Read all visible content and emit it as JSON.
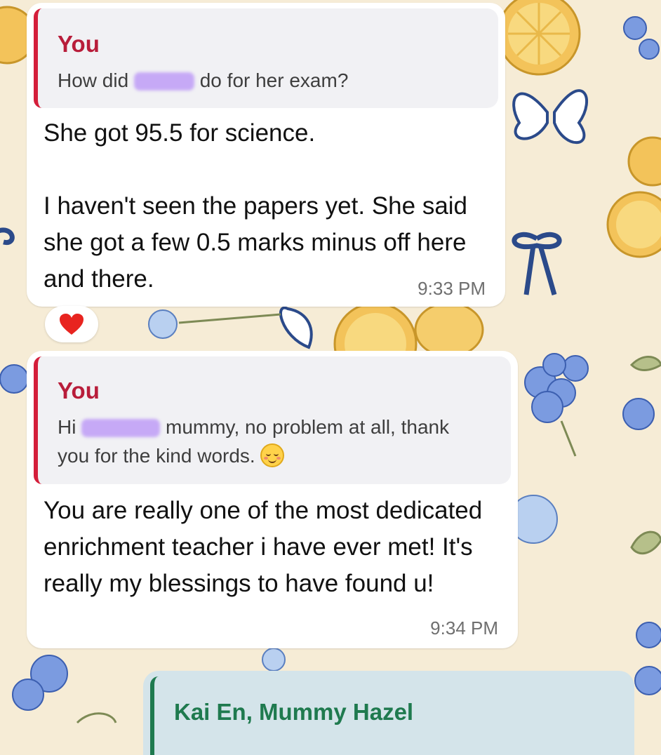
{
  "colors": {
    "quote_accent": "#d41e3a",
    "quote_author": "#b81d3a",
    "outgoing_bubble": "#d4e4ea",
    "outgoing_quote_author": "#1f7a4f",
    "wallpaper": "#f6ecd6"
  },
  "messages": [
    {
      "quote": {
        "author": "You",
        "text_before": "How did",
        "text_after": "do for her exam?"
      },
      "body": "She got 95.5 for science.\n\nI haven't seen the papers yet. She said she got a few 0.5 marks minus off here and there.",
      "time": "9:33 PM",
      "reaction": "red-heart"
    },
    {
      "quote": {
        "author": "You",
        "text_before": "Hi",
        "text_after": "mummy, no problem at all, thank",
        "text_line2": "you for the kind words.",
        "emoji": "smiling-face-with-blush"
      },
      "body": "You are really one of the most dedicated enrichment teacher i have ever met! It's really my blessings to have found u!",
      "time": "9:34 PM"
    }
  ],
  "outgoing": {
    "quote_author": "Kai En, Mummy Hazel"
  }
}
